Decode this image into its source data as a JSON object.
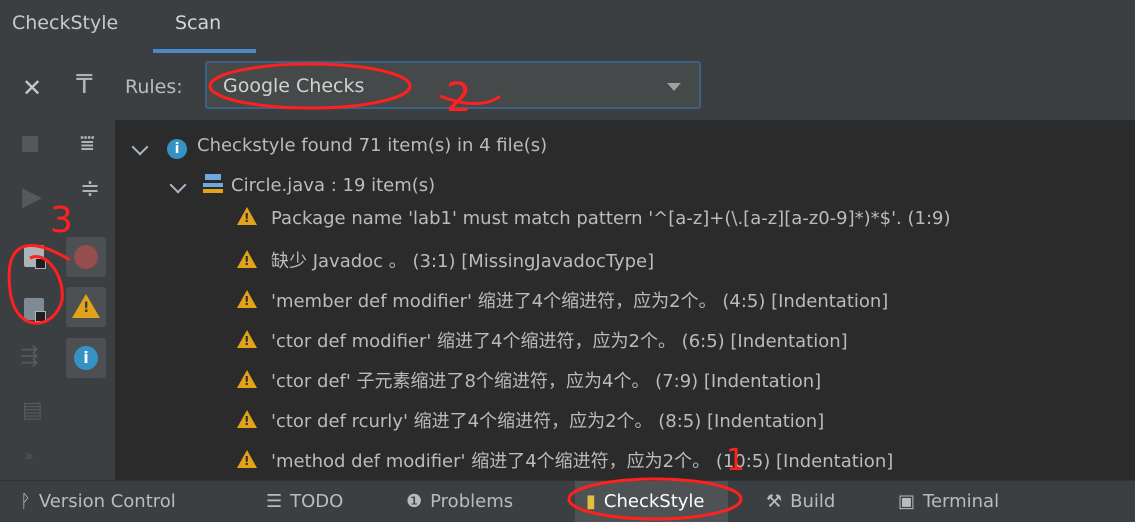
{
  "tabs": {
    "checkstyle": "CheckStyle",
    "scan": "Scan"
  },
  "rules": {
    "label": "Rules:",
    "selected": "Google Checks"
  },
  "toolbar_icons": [
    "close-icon",
    "pin-icon",
    "stop-icon",
    "expand-all-icon",
    "run-icon",
    "collapse-all-icon",
    "check-current-file-icon",
    "check-module-icon",
    "check-project-icon",
    "scope-icon",
    "error-filter-icon",
    "warning-filter-icon",
    "info-filter-icon",
    "more-icon"
  ],
  "tree": {
    "summary": "Checkstyle found 71 item(s) in 4 file(s)",
    "file": "Circle.java : 19 item(s)",
    "items": [
      "Package name 'lab1' must match pattern '^[a-z]+(\\.[a-z][a-z0-9]*)*$'. (1:9)",
      "缺少 Javadoc 。 (3:1) [MissingJavadocType]",
      "'member def modifier' 缩进了4个缩进符，应为2个。 (4:5) [Indentation]",
      "'ctor def modifier' 缩进了4个缩进符，应为2个。 (6:5) [Indentation]",
      "'ctor def' 子元素缩进了8个缩进符，应为4个。 (7:9) [Indentation]",
      "'ctor def rcurly' 缩进了4个缩进符，应为2个。 (8:5) [Indentation]",
      "'method def modifier' 缩进了4个缩进符，应为2个。 (10:5) [Indentation]"
    ]
  },
  "bottom_tabs": [
    {
      "label": "Version Control",
      "icon": "version-control-icon"
    },
    {
      "label": "TODO",
      "icon": "todo-icon"
    },
    {
      "label": "Problems",
      "icon": "problems-icon"
    },
    {
      "label": "CheckStyle",
      "icon": "checkstyle-icon"
    },
    {
      "label": "Build",
      "icon": "build-icon"
    },
    {
      "label": "Terminal",
      "icon": "terminal-icon"
    }
  ],
  "annotations": {
    "one": "1",
    "two": "2",
    "three": "3"
  },
  "colors": {
    "accent": "#4a88c7",
    "warning": "#e0a31a",
    "info": "#3592c4",
    "annotation": "#ff2020"
  }
}
